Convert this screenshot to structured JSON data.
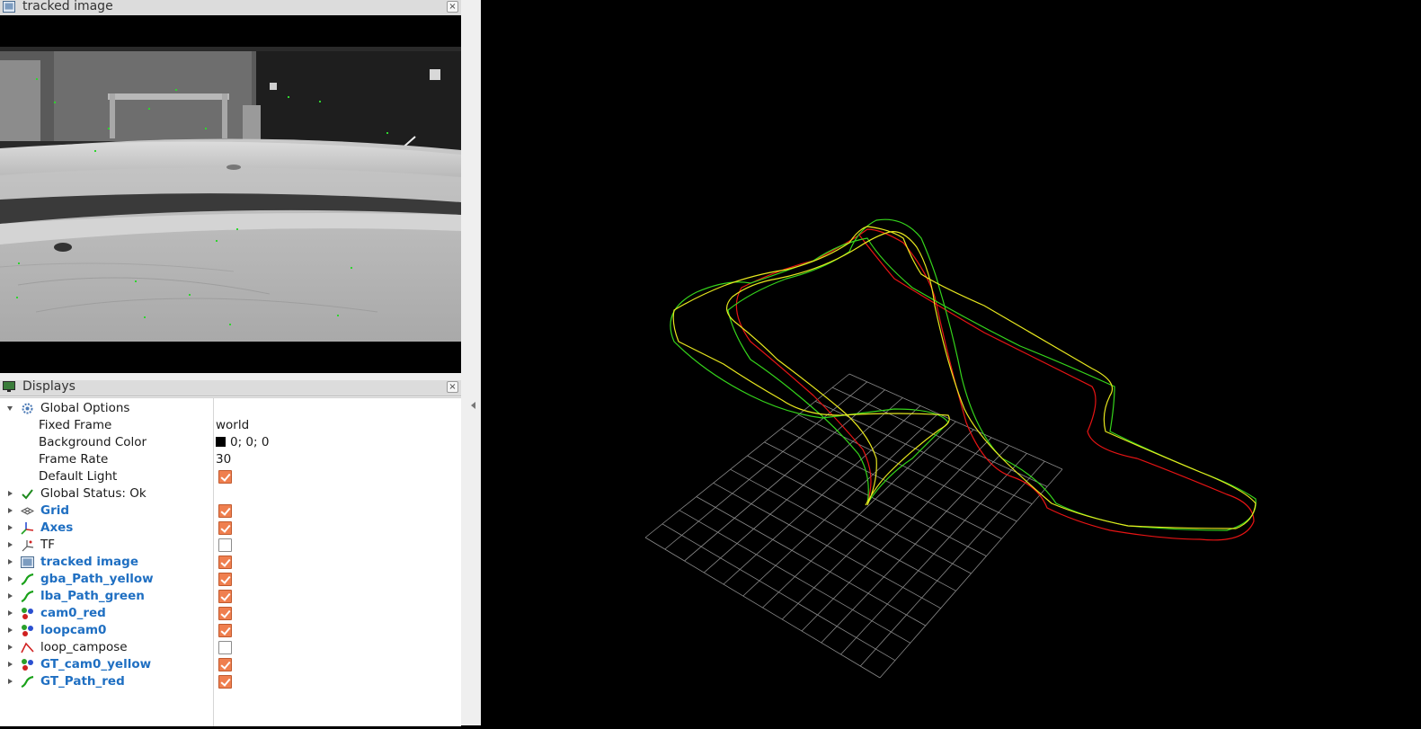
{
  "image_panel": {
    "title": "tracked image"
  },
  "displays_panel": {
    "title": "Displays",
    "global_options": {
      "label": "Global Options",
      "fixed_frame": {
        "label": "Fixed Frame",
        "value": "world"
      },
      "background_color": {
        "label": "Background Color",
        "value": "0; 0; 0"
      },
      "frame_rate": {
        "label": "Frame Rate",
        "value": "30"
      },
      "default_light": {
        "label": "Default Light",
        "checked": true
      }
    },
    "global_status": {
      "label": "Global Status: Ok"
    },
    "items": [
      {
        "label": "Grid",
        "icon": "grid-icon",
        "checked": true,
        "highlight": true
      },
      {
        "label": "Axes",
        "icon": "axes-icon",
        "checked": true,
        "highlight": true
      },
      {
        "label": "TF",
        "icon": "tf-icon",
        "checked": false,
        "highlight": false
      },
      {
        "label": "tracked image",
        "icon": "image-icon",
        "checked": true,
        "highlight": true
      },
      {
        "label": "gba_Path_yellow",
        "icon": "path-icon",
        "checked": true,
        "highlight": true
      },
      {
        "label": "lba_Path_green",
        "icon": "path-icon",
        "checked": true,
        "highlight": true
      },
      {
        "label": "cam0_red",
        "icon": "marker-array-icon",
        "checked": true,
        "highlight": true
      },
      {
        "label": "loopcam0",
        "icon": "marker-array-icon",
        "checked": true,
        "highlight": true
      },
      {
        "label": "loop_campose",
        "icon": "pose-line-icon",
        "checked": false,
        "highlight": false
      },
      {
        "label": "GT_cam0_yellow",
        "icon": "marker-array-icon",
        "checked": true,
        "highlight": true
      },
      {
        "label": "GT_Path_red",
        "icon": "path-icon",
        "checked": true,
        "highlight": true
      }
    ]
  },
  "colors": {
    "path_yellow": "#e8e81e",
    "path_green": "#35d41b",
    "path_red": "#e81414",
    "grid": "#8a8a8a",
    "label_blue": "#1f6fc2",
    "checkbox_orange": "#ef7f4f"
  }
}
